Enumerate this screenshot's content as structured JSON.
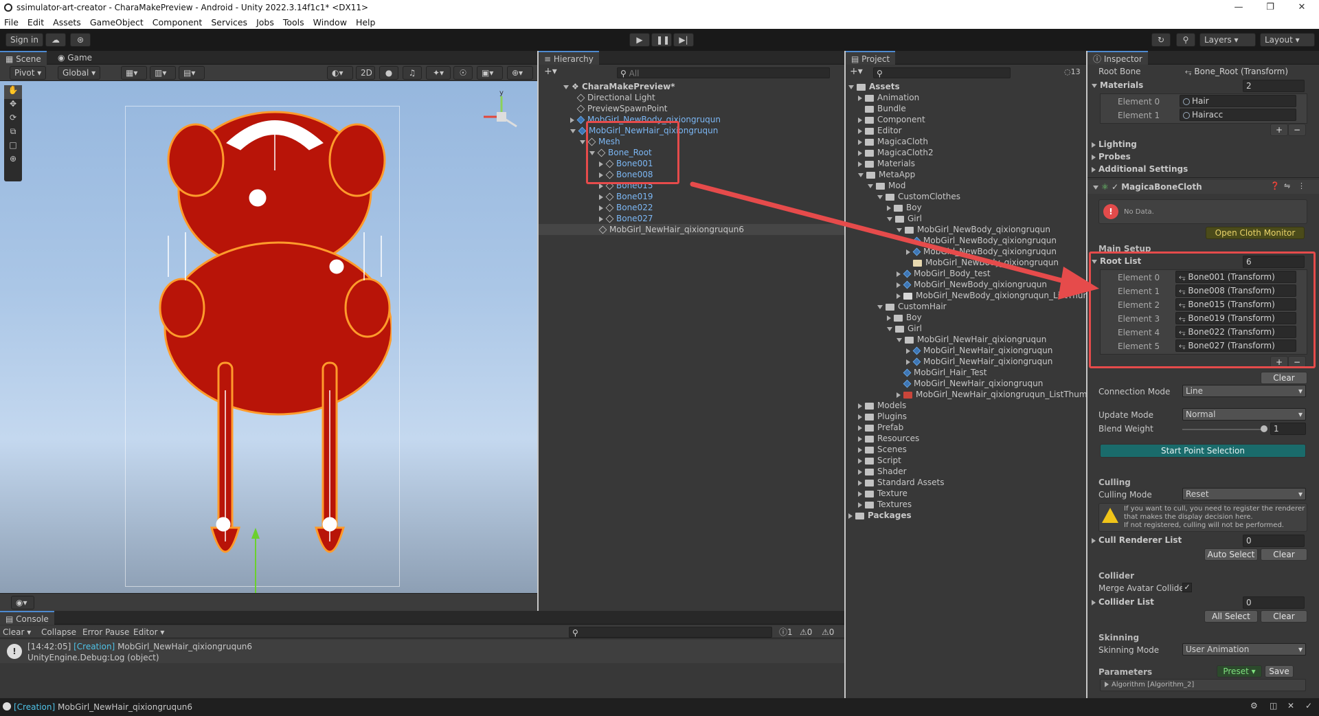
{
  "window": {
    "title": "ssimulator-art-creator - CharaMakePreview - Android - Unity 2022.3.14f1c1* <DX11>"
  },
  "menu": [
    "File",
    "Edit",
    "Assets",
    "GameObject",
    "Component",
    "Services",
    "Jobs",
    "Tools",
    "Window",
    "Help"
  ],
  "toolbar": {
    "sign_in": "Sign in",
    "layers": "Layers",
    "layout": "Layout"
  },
  "scene": {
    "tabs": [
      "Scene",
      "Game"
    ],
    "pivot": "Pivot",
    "global": "Global",
    "mode2d": "2D",
    "axis_y": "y"
  },
  "hierarchy": {
    "tab": "Hierarchy",
    "search_placeholder": "All",
    "root": "CharaMakePreview*",
    "items": [
      {
        "label": "Directional Light",
        "depth": 1
      },
      {
        "label": "PreviewSpawnPoint",
        "depth": 1
      },
      {
        "label": "MobGirl_NewBody_qixiongruqun",
        "depth": 1
      },
      {
        "label": "MobGirl_NewHair_qixiongruqun",
        "depth": 1
      },
      {
        "label": "Mesh",
        "depth": 2
      },
      {
        "label": "Bone_Root",
        "depth": 3
      },
      {
        "label": "Bone001",
        "depth": 4
      },
      {
        "label": "Bone008",
        "depth": 4
      },
      {
        "label": "Bone015",
        "depth": 4
      },
      {
        "label": "Bone019",
        "depth": 4
      },
      {
        "label": "Bone022",
        "depth": 4
      },
      {
        "label": "Bone027",
        "depth": 4
      },
      {
        "label": "MobGirl_NewHair_qixiongruqun6",
        "depth": 2
      }
    ]
  },
  "project": {
    "tab": "Project",
    "count": "13",
    "items": [
      "Assets",
      "Animation",
      "Bundle",
      "Component",
      "Editor",
      "MagicaCloth",
      "MagicaCloth2",
      "Materials",
      "MetaApp",
      "Mod",
      "CustomClothes",
      "Boy",
      "Girl",
      "MobGirl_NewBody_qixiongruqun",
      "MobGirl_NewBody_qixiongruqun",
      "MobGirl_NewBody_qixiongruqun",
      "MobGirl_NewBody_qixiongruqun",
      "MobGirl_Body_test",
      "MobGirl_NewBody_qixiongruqun",
      "MobGirl_NewBody_qixiongruqun_ListThumb",
      "CustomHair",
      "Boy",
      "Girl",
      "MobGirl_NewHair_qixiongruqun",
      "MobGirl_NewHair_qixiongruqun",
      "MobGirl_NewHair_qixiongruqun",
      "MobGirl_Hair_Test",
      "MobGirl_NewHair_qixiongruqun",
      "MobGirl_NewHair_qixiongruqun_ListThumbr",
      "Models",
      "Plugins",
      "Prefab",
      "Resources",
      "Scenes",
      "Script",
      "Shader",
      "Standard Assets",
      "Texture",
      "Textures",
      "Packages"
    ]
  },
  "inspector": {
    "tab": "Inspector",
    "root_bone_label": "Root Bone",
    "root_bone_value": "Bone_Root (Transform)",
    "materials_label": "Materials",
    "materials_count": "2",
    "materials": [
      {
        "label": "Element 0",
        "value": "Hair"
      },
      {
        "label": "Element 1",
        "value": "Hairacc"
      }
    ],
    "lighting": "Lighting",
    "probes": "Probes",
    "additional": "Additional Settings",
    "component": "MagicaBoneCloth",
    "no_data": "No Data.",
    "open_monitor": "Open Cloth Monitor",
    "main_setup": "Main Setup",
    "root_list_label": "Root List",
    "root_list_count": "6",
    "root_list": [
      {
        "label": "Element 0",
        "value": "Bone001 (Transform)"
      },
      {
        "label": "Element 1",
        "value": "Bone008 (Transform)"
      },
      {
        "label": "Element 2",
        "value": "Bone015 (Transform)"
      },
      {
        "label": "Element 3",
        "value": "Bone019 (Transform)"
      },
      {
        "label": "Element 4",
        "value": "Bone022 (Transform)"
      },
      {
        "label": "Element 5",
        "value": "Bone027 (Transform)"
      }
    ],
    "clear": "Clear",
    "connection_label": "Connection Mode",
    "connection_value": "Line",
    "update_label": "Update Mode",
    "update_value": "Normal",
    "blend_label": "Blend Weight",
    "blend_value": "1",
    "start_point": "Start Point Selection",
    "culling": "Culling",
    "culling_mode_label": "Culling Mode",
    "culling_mode_value": "Reset",
    "culling_warning": [
      "If you want to cull, you need to register the renderer",
      "that makes the display decision here.",
      "If not registered, culling will not be performed."
    ],
    "cull_list_label": "Cull Renderer List",
    "cull_list_count": "0",
    "auto_select": "Auto Select",
    "collider": "Collider",
    "merge_label": "Merge Avatar Collide",
    "collider_list_label": "Collider List",
    "collider_list_count": "0",
    "all_select": "All Select",
    "skinning": "Skinning",
    "skinning_mode_label": "Skinning Mode",
    "skinning_mode_value": "User Animation",
    "parameters": "Parameters",
    "preset": "Preset",
    "save": "Save",
    "algorithm": "Algorithm [Algorithm_2]"
  },
  "console": {
    "tab": "Console",
    "clear": "Clear",
    "collapse": "Collapse",
    "error_pause": "Error Pause",
    "editor": "Editor",
    "counts": [
      "1",
      "0",
      "0"
    ],
    "log_time": "[14:42:05]",
    "log_tag": "[Creation]",
    "log_msg": "MobGirl_NewHair_qixiongruqun6",
    "log_line2": "UnityEngine.Debug:Log (object)"
  },
  "status": {
    "tag": "[Creation]",
    "msg": "MobGirl_NewHair_qixiongruqun6"
  }
}
